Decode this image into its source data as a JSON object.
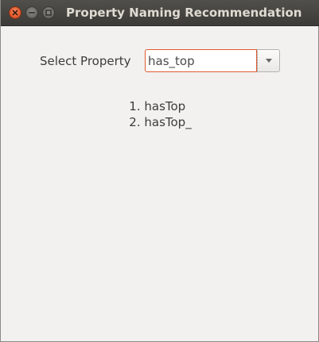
{
  "window": {
    "title": "Property Naming Recommendation",
    "buttons": {
      "close": "close-icon",
      "minimize": "minimize-icon",
      "maximize": "maximize-icon"
    }
  },
  "form": {
    "select_label": "Select Property",
    "property_value": "has_top",
    "dropdown_icon": "chevron-down-icon"
  },
  "recommendations": [
    {
      "number": "1.",
      "name": "hasTop"
    },
    {
      "number": "2.",
      "name": "hasTop_"
    }
  ],
  "colors": {
    "titlebar": "#3c3b37",
    "title_text": "#dfdbd2",
    "close_button": "#e35a2c",
    "window_bg": "#f2f1f0",
    "focus_border": "#e05a2e"
  }
}
